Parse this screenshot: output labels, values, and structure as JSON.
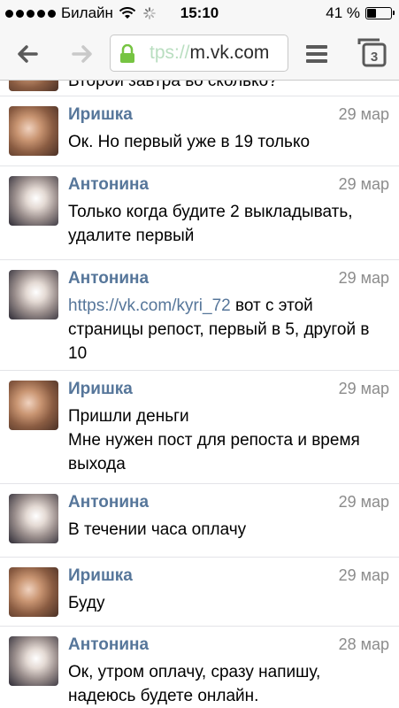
{
  "status_bar": {
    "carrier": "Билайн",
    "time": "15:10",
    "battery": "41 %",
    "battery_level": 0.41,
    "signal_bars": 5
  },
  "browser": {
    "url_faded": "tps://",
    "url_main": "m.vk.com",
    "tabs_count": "3",
    "icons": [
      "back-arrow-icon",
      "forward-arrow-icon",
      "lock-icon",
      "menu-icon",
      "tabs-icon"
    ]
  },
  "partial_message": {
    "text": "Второй завтра во сколько?"
  },
  "messages": [
    {
      "author": "Иришка",
      "date": "29 мар",
      "text": "Ок. Но первый уже в 19 только"
    },
    {
      "author": "Антонина",
      "date": "29 мар",
      "text": "Только когда будите 2 выкладывать, удалите первый"
    },
    {
      "author": "Антонина",
      "date": "29 мар",
      "link": "https://vk.com/kyri_72",
      "text": " вот с этой страницы репост, первый в 5, другой в 10"
    },
    {
      "author": "Иришка",
      "date": "29 мар",
      "line1": "Пришли деньги",
      "line2": "Мне нужен пост для репоста и время выхода"
    },
    {
      "author": "Антонина",
      "date": "29 мар",
      "text": "В течении часа оплачу"
    },
    {
      "author": "Иришка",
      "date": "29 мар",
      "text": "Буду"
    },
    {
      "author": "Антонина",
      "date": "28 мар",
      "text": "Ок, утром оплачу, сразу напишу, надеюсь будете онлайн."
    }
  ],
  "colors": {
    "link_blue": "#56769a",
    "date_gray": "#8c8c8c",
    "lock_green": "#76c442"
  }
}
